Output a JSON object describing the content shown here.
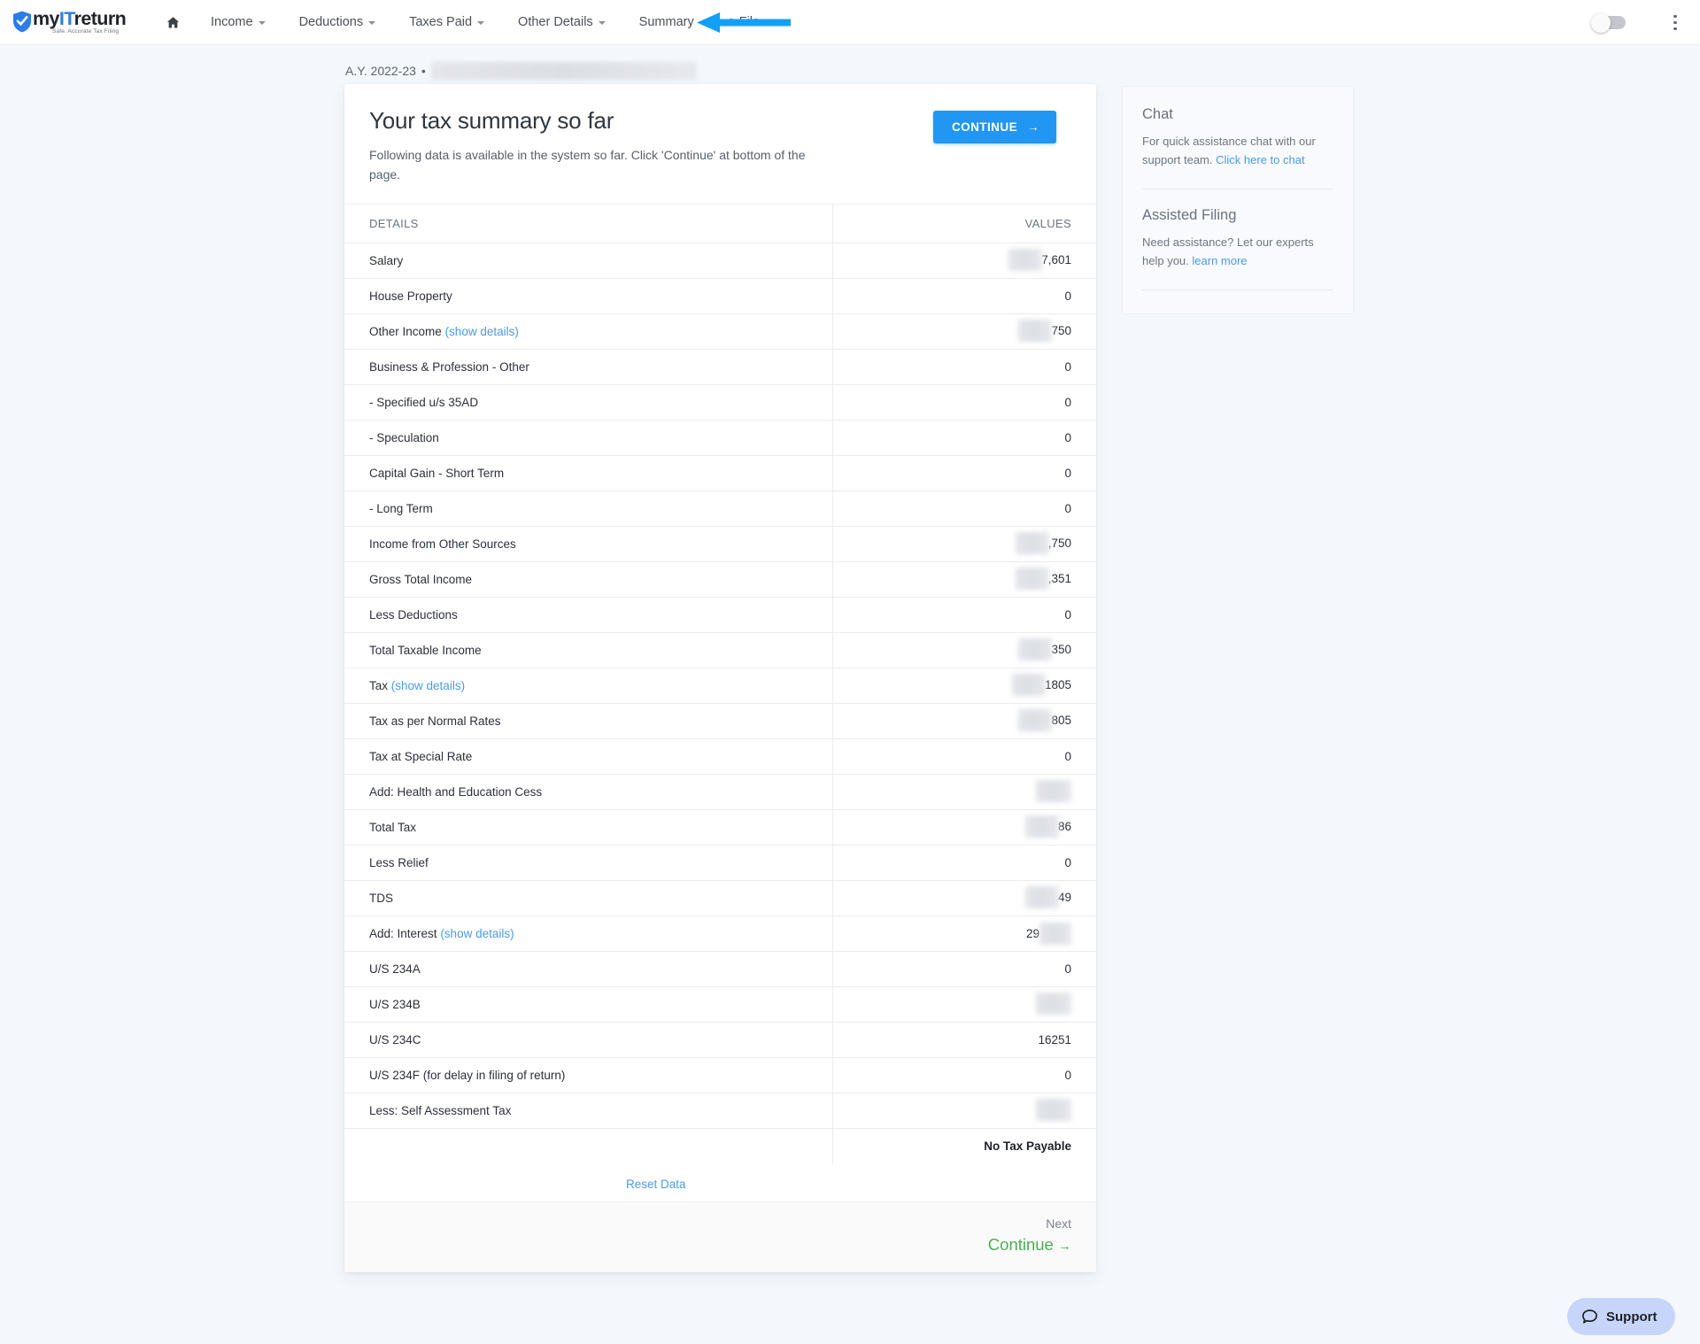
{
  "brand": {
    "name_prefix": "my",
    "name_mid": "IT",
    "name_suffix": "return",
    "tagline": "Safe. Accurate Tax Filing"
  },
  "nav": {
    "home_icon": "home-icon",
    "items": [
      {
        "label": "Income",
        "has_caret": true
      },
      {
        "label": "Deductions",
        "has_caret": true
      },
      {
        "label": "Taxes Paid",
        "has_caret": true
      },
      {
        "label": "Other Details",
        "has_caret": true
      },
      {
        "label": "Summary",
        "has_caret": false
      },
      {
        "label": "e-File",
        "has_caret": false
      }
    ],
    "annotation": "blue-left-arrow pointing at e-File",
    "toggle_state": "off",
    "menu_icon": "kebab-menu-icon"
  },
  "breadcrumb": {
    "assessment_year": "A.Y. 2022-23",
    "separator": "•",
    "redacted_name": ""
  },
  "card": {
    "title": "Your tax summary so far",
    "subtitle": "Following data is available in the system so far. Click 'Continue' at bottom of the page.",
    "continue_button": "CONTINUE",
    "continue_arrow": "→"
  },
  "table": {
    "headers": {
      "details": "DETAILS",
      "values": "VALUES"
    },
    "rows": [
      {
        "label": "Salary",
        "link": "",
        "value": "7,601",
        "blur": "pre"
      },
      {
        "label": "House Property",
        "link": "",
        "value": "0",
        "blur": "none"
      },
      {
        "label": "Other Income",
        "link": "(show details)",
        "value": "750",
        "blur": "pre"
      },
      {
        "label": "Business & Profession - Other",
        "link": "",
        "value": "0",
        "blur": "none"
      },
      {
        "label": "- Specified u/s 35AD",
        "link": "",
        "value": "0",
        "blur": "none"
      },
      {
        "label": "- Speculation",
        "link": "",
        "value": "0",
        "blur": "none"
      },
      {
        "label": "Capital Gain - Short Term",
        "link": "",
        "value": "0",
        "blur": "none"
      },
      {
        "label": "- Long Term",
        "link": "",
        "value": "0",
        "blur": "none"
      },
      {
        "label": "Income from Other Sources",
        "link": "",
        "value": ",750",
        "blur": "pre"
      },
      {
        "label": "Gross Total Income",
        "link": "",
        "value": ",351",
        "blur": "pre"
      },
      {
        "label": "Less Deductions",
        "link": "",
        "value": "0",
        "blur": "none"
      },
      {
        "label": "Total Taxable Income",
        "link": "",
        "value": "350",
        "blur": "pre"
      },
      {
        "label": "Tax",
        "link": "(show details)",
        "value": "1805",
        "blur": "pre"
      },
      {
        "label": "Tax as per Normal Rates",
        "link": "",
        "value": "805",
        "blur": "pre"
      },
      {
        "label": "Tax at Special Rate",
        "link": "",
        "value": "0",
        "blur": "none"
      },
      {
        "label": "Add: Health and Education Cess",
        "link": "",
        "value": "",
        "blur": "full"
      },
      {
        "label": "Total Tax",
        "link": "",
        "value": "86",
        "blur": "pre"
      },
      {
        "label": "Less Relief",
        "link": "",
        "value": "0",
        "blur": "none"
      },
      {
        "label": "TDS",
        "link": "",
        "value": "49",
        "blur": "pre"
      },
      {
        "label": "Add: Interest",
        "link": "(show details)",
        "value": "29",
        "blur": "post"
      },
      {
        "label": "U/S 234A",
        "link": "",
        "value": "0",
        "blur": "none"
      },
      {
        "label": "U/S 234B",
        "link": "",
        "value": "",
        "blur": "full"
      },
      {
        "label": "U/S 234C",
        "link": "",
        "value": "16251",
        "blur": "none"
      },
      {
        "label": "U/S 234F (for delay in filing of return)",
        "link": "",
        "value": "0",
        "blur": "none"
      },
      {
        "label": "Less: Self Assessment Tax",
        "link": "",
        "value": "",
        "blur": "full"
      }
    ],
    "total_row": {
      "label": "",
      "value": "No Tax Payable"
    }
  },
  "footer": {
    "reset_link": "Reset Data",
    "next_label": "Next",
    "continue_label": "Continue",
    "continue_arrow": "→"
  },
  "sidebar": {
    "chat": {
      "title": "Chat",
      "text": "For quick assistance chat with our support team.",
      "link": "Click here to chat"
    },
    "assisted": {
      "title": "Assisted Filing",
      "text": "Need assistance? Let our experts help you.",
      "link": "learn more"
    }
  },
  "support_widget": {
    "label": "Support",
    "icon": "chat-bubble-icon"
  },
  "colors": {
    "accent_blue": "#2196f3",
    "link_blue": "#4a9ae8",
    "continue_green": "#4caf50",
    "annotation_blue": "#12a0f7",
    "page_bg": "#f4f8fd",
    "support_bg": "#c7d5fa"
  }
}
